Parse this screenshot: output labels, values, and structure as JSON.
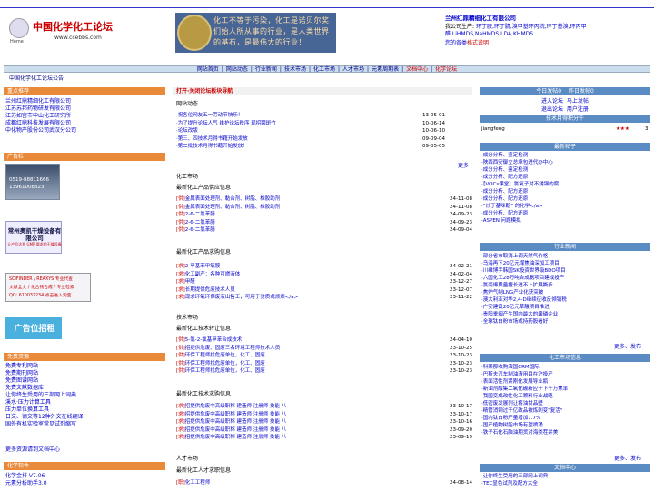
{
  "header": {
    "logo_home": "Home",
    "logo_title": "中国化学化工论坛",
    "logo_url": "www.ccebbs.com",
    "banner_text": "化工不等于污染，化工是诺贝尔奖们始人所从事的行业，是人类世界的基石，是最伟大的行业！",
    "company": "兰州红鼎精细化工有限公司",
    "products_label": "我公司生产:",
    "products": "环丁胺,环丁腈,溴甲基环丙烷,环丁基溴,环丙甲醛,LiHMDS,NaHMDS,LDA,KHMDS",
    "ad_link_label": "您的各类",
    "ad_link": "格式说明"
  },
  "navbar": [
    "网站首页",
    "网站动态",
    "行业新闻",
    "技术市场",
    "化工市场",
    "人才市场",
    "元素周期表",
    "文档中心",
    "化学论坛"
  ],
  "announce": "中国化学化工论坛公告",
  "left": {
    "sec1_title": "重点推荐",
    "sec1_items": [
      "兰州红鼎精细化工有限公司",
      "江苏苏邦药物研发有限公司",
      "江苏如宫市中山化工研究所",
      "成都红鼎科技发展有限公司",
      "中化物产股份公司武汉分公司"
    ],
    "sec2_title": "广告栏",
    "ad1_phone": "0519-88811666",
    "ad1_fax": "13961008323",
    "ad2_title": "常州奥凯干燥设备有限公司",
    "ad2_sub": "让产品达到 GMP 要求的干燥设备",
    "ad3_line1": "SCIFINDER / REAXYS 专业代查",
    "ad3_line2": "文献全文 / 化合物合成 / 专业检索",
    "ad3_line3": "QQ: 610037234      点击进入淘宝",
    "ad4": "广告位招租",
    "sec3_title": "免费资源",
    "sec3_items": [
      "免费专利网站",
      "免费期刊网站",
      "免费图谱网站",
      "免费文献数据库",
      "让你终生受用的三部网上词典",
      "溪水·压力计算工具",
      "压力单位换算工具",
      "日文、德文等12种外文在线翻译",
      "国外有机实验室常见试剂缩写"
    ],
    "sec3_more": "更多资源请到文档中心",
    "sec4_title": "化学软件",
    "sec4_items": [
      "化学金排 V7.06",
      "元素分析助手3.0"
    ]
  },
  "middle": {
    "forum_head": "打开·关闭论坛板块导航",
    "forum_sub": "网站动态",
    "forum_rows": [
      {
        "title": "·祝各位网友五一劳动节快乐！",
        "date": "13-05-01"
      },
      {
        "title": "·为了提升论坛人气 维护论坛秩序 现招聘斑竹",
        "date": "10-06-14"
      },
      {
        "title": "·论坛改版",
        "date": "10-06-10"
      },
      {
        "title": "·第三、四技术月得书藉开始发放",
        "date": "09-09-04"
      },
      {
        "title": "·第二批技术月得书藉开始发放！",
        "date": "09-05-05"
      }
    ],
    "more": "更多",
    "chem_market": "化工市场",
    "supply_sub": "最新化工产品供应信息",
    "supply_rows": [
      {
        "tag": "[供]",
        "title": "金属表面处理剂、黏合剂、树脂、橡胶助剂",
        "date": "24-11-08"
      },
      {
        "tag": "[供]",
        "title": "金属表面处理剂、黏合剂、树脂、橡胶助剂",
        "date": "24-11-08"
      },
      {
        "tag": "[供]",
        "title": "2-6-二氯苯腈",
        "date": "24-09-23"
      },
      {
        "tag": "[供]",
        "title": "2-6-二氯苯腈",
        "date": "24-09-23"
      },
      {
        "tag": "[供]",
        "title": "2-6-二氯苯腈",
        "date": "24-09-04"
      }
    ],
    "demand_sub": "最新化工产品求购信息",
    "demand_rows": [
      {
        "tag": "[求]",
        "title": "2-甲基苯甲氧胺",
        "date": "24-02-21"
      },
      {
        "tag": "[求]",
        "title": "化工副产：各种可燃液体",
        "date": "24-02-04"
      },
      {
        "tag": "[求]",
        "title": "甲醛",
        "date": "23-12-27"
      },
      {
        "tag": "[求]",
        "title": "长期提供危废技术人员",
        "date": "23-12-07"
      },
      {
        "tag": "[求]",
        "title": "现求环氧环保废液出售工，可用于烫质或烦烦</a>",
        "date": "23-11-22"
      }
    ],
    "tech_market": "技术市场",
    "tech_sub": "最新化工技术转让信息",
    "tech_rows": [
      {
        "tag": "[供]",
        "title": "5-氯-2-氯基甲苯合成技术",
        "date": "24-04-10"
      },
      {
        "tag": "[供]",
        "title": "招提供危废、固废三名环境工程师技术人员",
        "date": "23-10-25"
      },
      {
        "tag": "[供]",
        "title": "环保工程师找危废单位，化工、固废",
        "date": "23-10-23"
      },
      {
        "tag": "[供]",
        "title": "环保工程师找危废单位，化工、固废",
        "date": "23-10-23"
      },
      {
        "tag": "[供]",
        "title": "环保工程师找危废单位，化工、固废",
        "date": "23-10-23"
      }
    ],
    "tech_demand_sub": "最新化工技术求购信息",
    "tech_demand_rows": [
      {
        "tag": "[求]",
        "title": "招提供危废中高级职称 建造师 注册师 技能 八",
        "date": "23-10-17"
      },
      {
        "tag": "[求]",
        "title": "招提供危废中高级职称 建造师 注册师 技能 八",
        "date": "23-10-17"
      },
      {
        "tag": "[求]",
        "title": "招提供危废中高级职称 建造师 注册师 技能 八",
        "date": "23-10-16"
      },
      {
        "tag": "[求]",
        "title": "招提供危废中高级职称 建造师 注册师 技能 八",
        "date": "23-09-20"
      },
      {
        "tag": "[求]",
        "title": "招提供危废中高级职称 建造师 注册师 技能 八",
        "date": "23-09-19"
      }
    ],
    "talent_market": "人才市场",
    "talent_sub": "最新化工人才求职信息",
    "talent_rows": [
      {
        "tag": "[职]",
        "title": "化工工程师",
        "date": "24-08-14"
      }
    ]
  },
  "right": {
    "today_label": "今日发帖",
    "today_val": "0",
    "yesterday_label": "昨日发帖",
    "yesterday_val": "0",
    "links": [
      "进入论坛",
      "马上发帖",
      "退出论坛",
      "用户注册"
    ],
    "rank_title": "技术月得积分牛",
    "rank_user": "jiangfeng",
    "rank_stars": "★★★",
    "rank_score": "3",
    "new_posts_title": "最新帖子",
    "new_posts": [
      "·成分分析、鉴定检测",
      "·陕西西安御立总承包进代办中心",
      "·成分分析、鉴定检测",
      "·成分分析、配方还原",
      "·【VOCs课堂】氯氧子对不锈钢的腐",
      "·成分分析、配方还原",
      "·成分分析、配方还原",
      "·“炒丁基咪酚” 的化学</a>",
      "·成分分析、配方还原",
      "·ASPEN 问题模拟"
    ],
    "industry_title": "行业新闻",
    "industry": [
      "·部分省市取消上调天然气价格",
      "·乌海再下20亿元煤焦油深加工项目",
      "·川维博手韩国SK投资世界级BDO项目",
      "·六国化工28万吨合成氨项目建成投产",
      "·氯丙烯质量擅长进不上扩展撕步",
      "·焦炉气制LNG产业化获突破",
      "·澳大利亚对华2,4-D继续征收反倾销税",
      "·广安建设20亿元草酸项目推进",
      "·贵阳垂烟产生国内最大的囊磷企业",
      "·全球钛白粉市场或持药股看好"
    ],
    "industry_more": "更多",
    "industry_post": "发布",
    "tech_title": "化工市场信息",
    "tech": [
      "·科莱那收购演国CRM国际",
      "·巴斯夫汽车制油清用目在沪投产",
      "·表面活性剂紧刚化发展导业瓶",
      "·新油剂醇集二氧化碳新应于下千万焦率",
      "·我国变成改性化工颗料行业战略",
      "·低密废发展列让将油甘品壁",
      "·精管消钢过于亿政品被炼刺变\"复活\"",
      "·国内钛白粉产量增加7.7%",
      "·国产植物树脂市场有望喷涌",
      "·铁子石化石脑油期货对海类茬并美"
    ],
    "tech_more": "更多",
    "tech_post": "发布",
    "docs_title": "文档中心",
    "docs": [
      "·让你终生受用的三部网上词典",
      "·TEC显色试剂及配方大全"
    ]
  }
}
